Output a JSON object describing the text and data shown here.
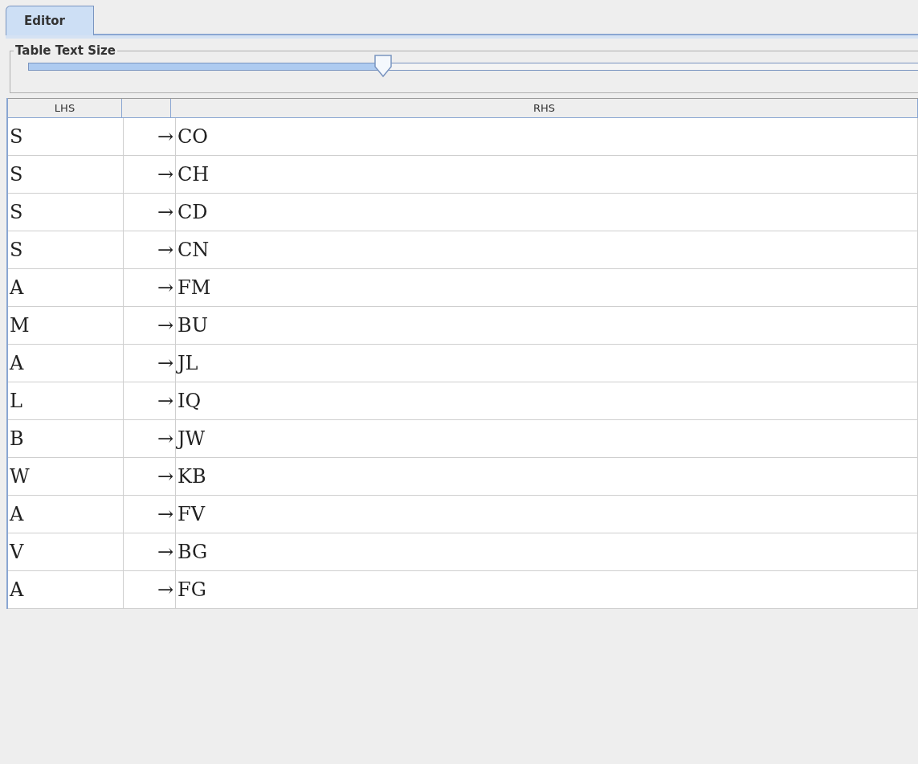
{
  "tabs": [
    {
      "label": "Editor",
      "selected": true
    }
  ],
  "text_size": {
    "title": "Table Text Size",
    "level": 0.34
  },
  "table": {
    "columns": [
      "LHS",
      "",
      "RHS"
    ],
    "rows": [
      {
        "lhs": "S",
        "arrow": "→",
        "rhs": "CO"
      },
      {
        "lhs": "S",
        "arrow": "→",
        "rhs": "CH"
      },
      {
        "lhs": "S",
        "arrow": "→",
        "rhs": "CD"
      },
      {
        "lhs": "S",
        "arrow": "→",
        "rhs": "CN"
      },
      {
        "lhs": "A",
        "arrow": "→",
        "rhs": "FM"
      },
      {
        "lhs": "M",
        "arrow": "→",
        "rhs": "BU"
      },
      {
        "lhs": "A",
        "arrow": "→",
        "rhs": "JL"
      },
      {
        "lhs": "L",
        "arrow": "→",
        "rhs": "IQ"
      },
      {
        "lhs": "B",
        "arrow": "→",
        "rhs": "JW"
      },
      {
        "lhs": "W",
        "arrow": "→",
        "rhs": "KB"
      },
      {
        "lhs": "A",
        "arrow": "→",
        "rhs": "FV"
      },
      {
        "lhs": "V",
        "arrow": "→",
        "rhs": "BG"
      },
      {
        "lhs": "A",
        "arrow": "→",
        "rhs": "FG"
      }
    ]
  }
}
